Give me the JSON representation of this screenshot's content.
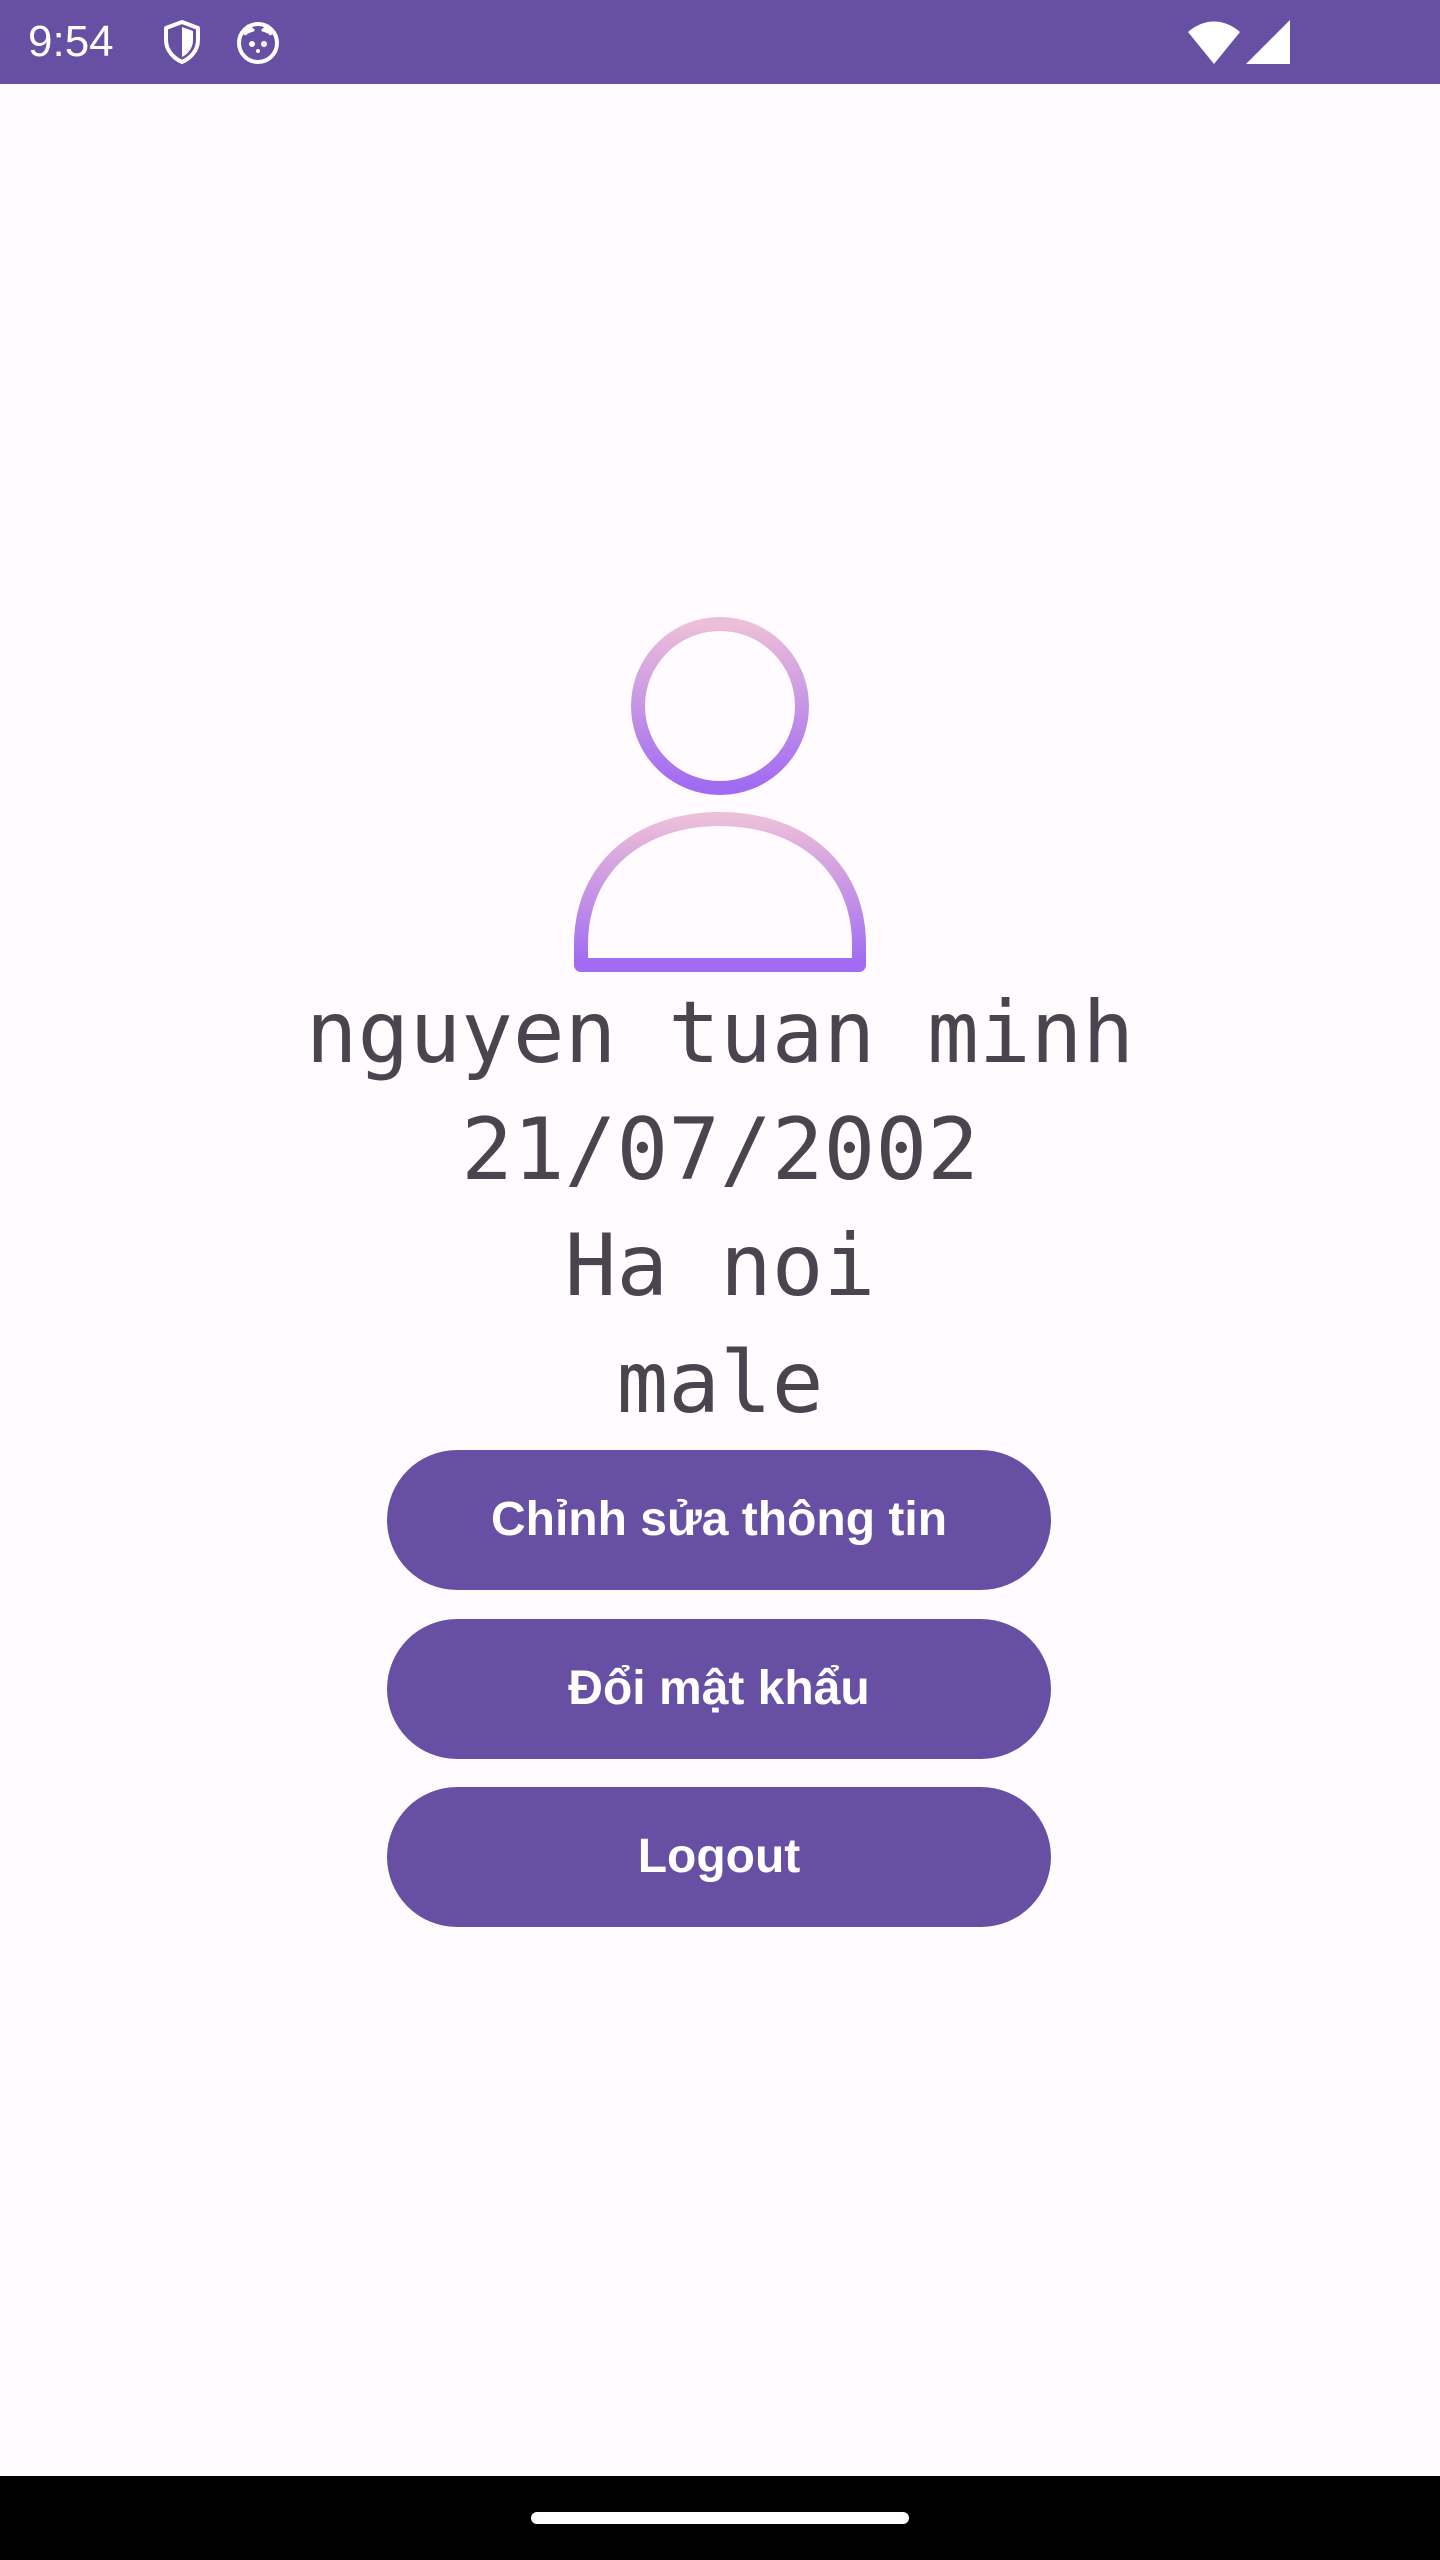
{
  "status_bar": {
    "time": "9:54",
    "icons": [
      "shield-icon",
      "cat-face-icon",
      "wifi-icon",
      "signal-icon"
    ],
    "color": "#6750a4"
  },
  "profile": {
    "avatar_icon": "user-profile-icon",
    "name": "nguyen tuan minh",
    "dob": "21/07/2002",
    "address": "Ha noi",
    "gender": "male"
  },
  "actions": {
    "edit_label": "Chỉnh sửa thông tin",
    "change_password_label": "Đổi mật khẩu",
    "logout_label": "Logout"
  },
  "colors": {
    "primary": "#6750a4",
    "background": "#fffbfe",
    "text": "#49454f",
    "avatar_gradient_top": "#ecbfd8",
    "avatar_gradient_bottom": "#a06af2"
  }
}
